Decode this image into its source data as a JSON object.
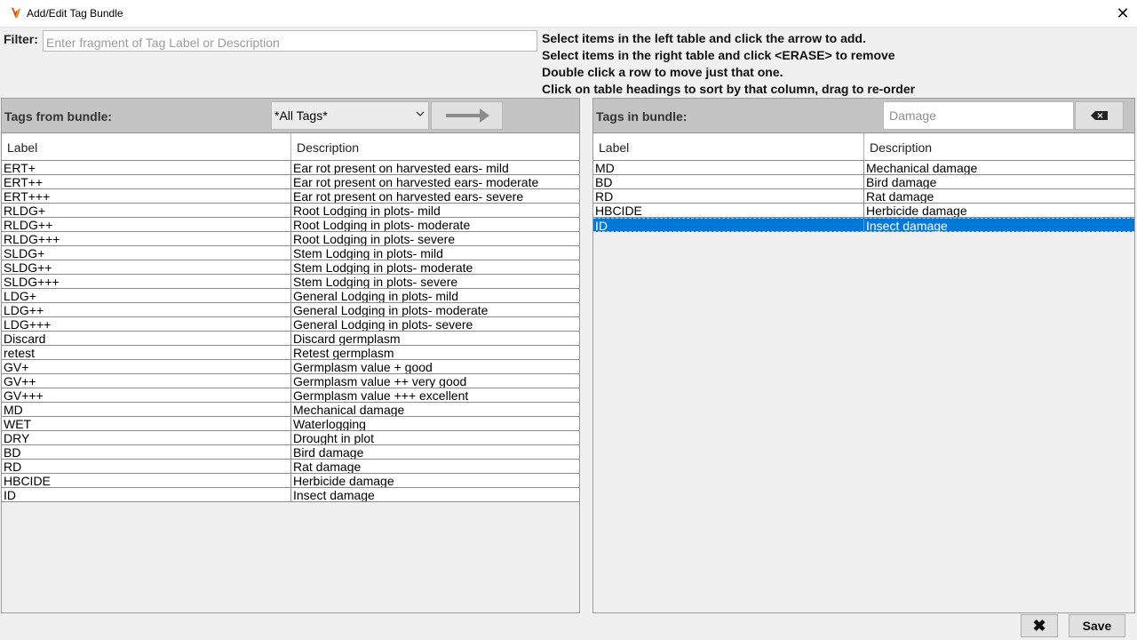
{
  "window": {
    "title": "Add/Edit Tag Bundle",
    "close_glyph": "✕"
  },
  "filter": {
    "label": "Filter:",
    "placeholder": "Enter fragment of Tag Label or Description",
    "value": ""
  },
  "instructions": [
    "Select items in the left table and click the arrow to add.",
    "Select items in the right table and click <ERASE> to remove",
    "Double click a row to move just that one.",
    "Click on table headings to sort by that column, drag to re-order"
  ],
  "left_panel": {
    "title": "Tags from bundle:",
    "select_value": "*All Tags*",
    "add_icon": "right-arrow-icon",
    "columns": [
      "Label",
      "Description"
    ],
    "rows": [
      [
        "ERT+",
        "Ear rot present on harvested ears- mild"
      ],
      [
        "ERT++",
        "Ear rot present on harvested ears- moderate"
      ],
      [
        "ERT+++",
        "Ear rot present on harvested ears- severe"
      ],
      [
        "RLDG+",
        "Root Lodging in plots- mild"
      ],
      [
        "RLDG++",
        "Root Lodging in plots- moderate"
      ],
      [
        "RLDG+++",
        "Root Lodging in plots- severe"
      ],
      [
        "SLDG+",
        "Stem Lodging in plots- mild"
      ],
      [
        "SLDG++",
        "Stem Lodging in plots- moderate"
      ],
      [
        "SLDG+++",
        "Stem Lodging in plots- severe"
      ],
      [
        "LDG+",
        "General Lodging in plots- mild"
      ],
      [
        "LDG++",
        "General Lodging in plots- moderate"
      ],
      [
        "LDG+++",
        "General Lodging in plots- severe"
      ],
      [
        "Discard",
        "Discard germplasm"
      ],
      [
        "retest",
        "Retest germplasm"
      ],
      [
        "GV+",
        "Germplasm value + good"
      ],
      [
        "GV++",
        "Germplasm value ++ very good"
      ],
      [
        "GV+++",
        "Germplasm value +++ excellent"
      ],
      [
        "MD",
        "Mechanical damage"
      ],
      [
        "WET",
        "Waterlogging"
      ],
      [
        "DRY",
        "Drought in plot"
      ],
      [
        "BD",
        "Bird damage"
      ],
      [
        "RD",
        "Rat damage"
      ],
      [
        "HBCIDE",
        "Herbicide damage"
      ],
      [
        "ID",
        "Insect damage"
      ]
    ]
  },
  "right_panel": {
    "title": "Tags in bundle:",
    "search_placeholder": "Damage",
    "erase_icon": "backspace-icon",
    "columns": [
      "Label",
      "Description"
    ],
    "selected_index": 4,
    "rows": [
      [
        "MD",
        "Mechanical damage"
      ],
      [
        "BD",
        "Bird damage"
      ],
      [
        "RD",
        "Rat damage"
      ],
      [
        "HBCIDE",
        "Herbicide damage"
      ],
      [
        "ID",
        "Insect damage"
      ]
    ]
  },
  "footer": {
    "cancel_glyph": "✖",
    "save_label": "Save"
  },
  "colors": {
    "selection": "#0078d7",
    "header_bar": "#c4c4c4",
    "background": "#f0f0f0"
  }
}
